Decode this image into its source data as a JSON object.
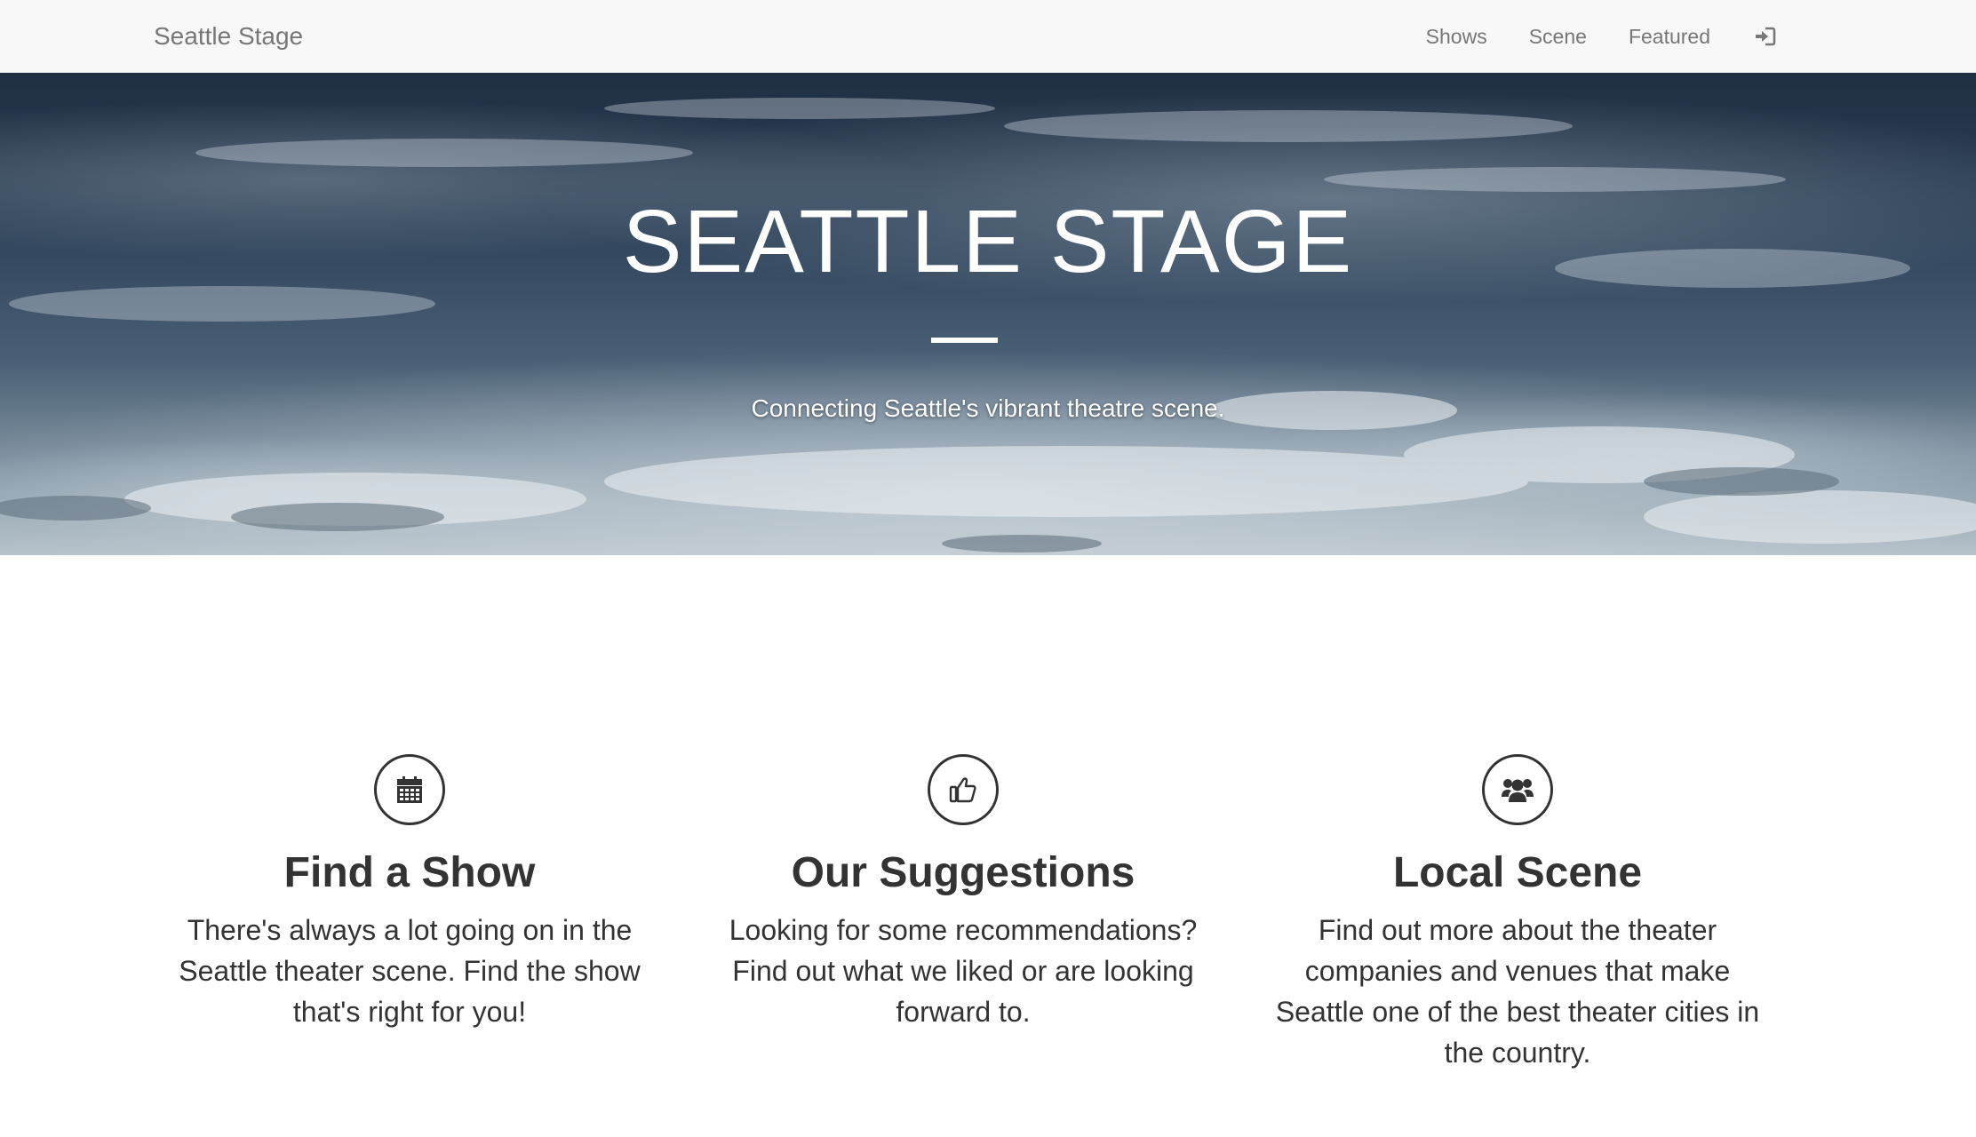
{
  "navbar": {
    "brand": "Seattle Stage",
    "links": [
      "Shows",
      "Scene",
      "Featured"
    ],
    "signin_icon": "sign-in-icon"
  },
  "hero": {
    "title": "SEATTLE STAGE",
    "subtitle": "Connecting Seattle's vibrant theatre scene."
  },
  "features": [
    {
      "icon": "calendar-icon",
      "title": "Find a Show",
      "text": "There's always a lot going on in the Seattle theater scene. Find the show that's right for you!"
    },
    {
      "icon": "thumbs-up-icon",
      "title": "Our Suggestions",
      "text": "Looking for some recommendations? Find out what we liked or are looking forward to."
    },
    {
      "icon": "users-icon",
      "title": "Local Scene",
      "text": "Find out more about the theater companies and venues that make Seattle one of the best theater cities in the country."
    }
  ],
  "colors": {
    "navbar_bg": "#f8f8f8",
    "nav_text": "#777777",
    "body_text": "#333333",
    "hero_text": "#ffffff"
  }
}
